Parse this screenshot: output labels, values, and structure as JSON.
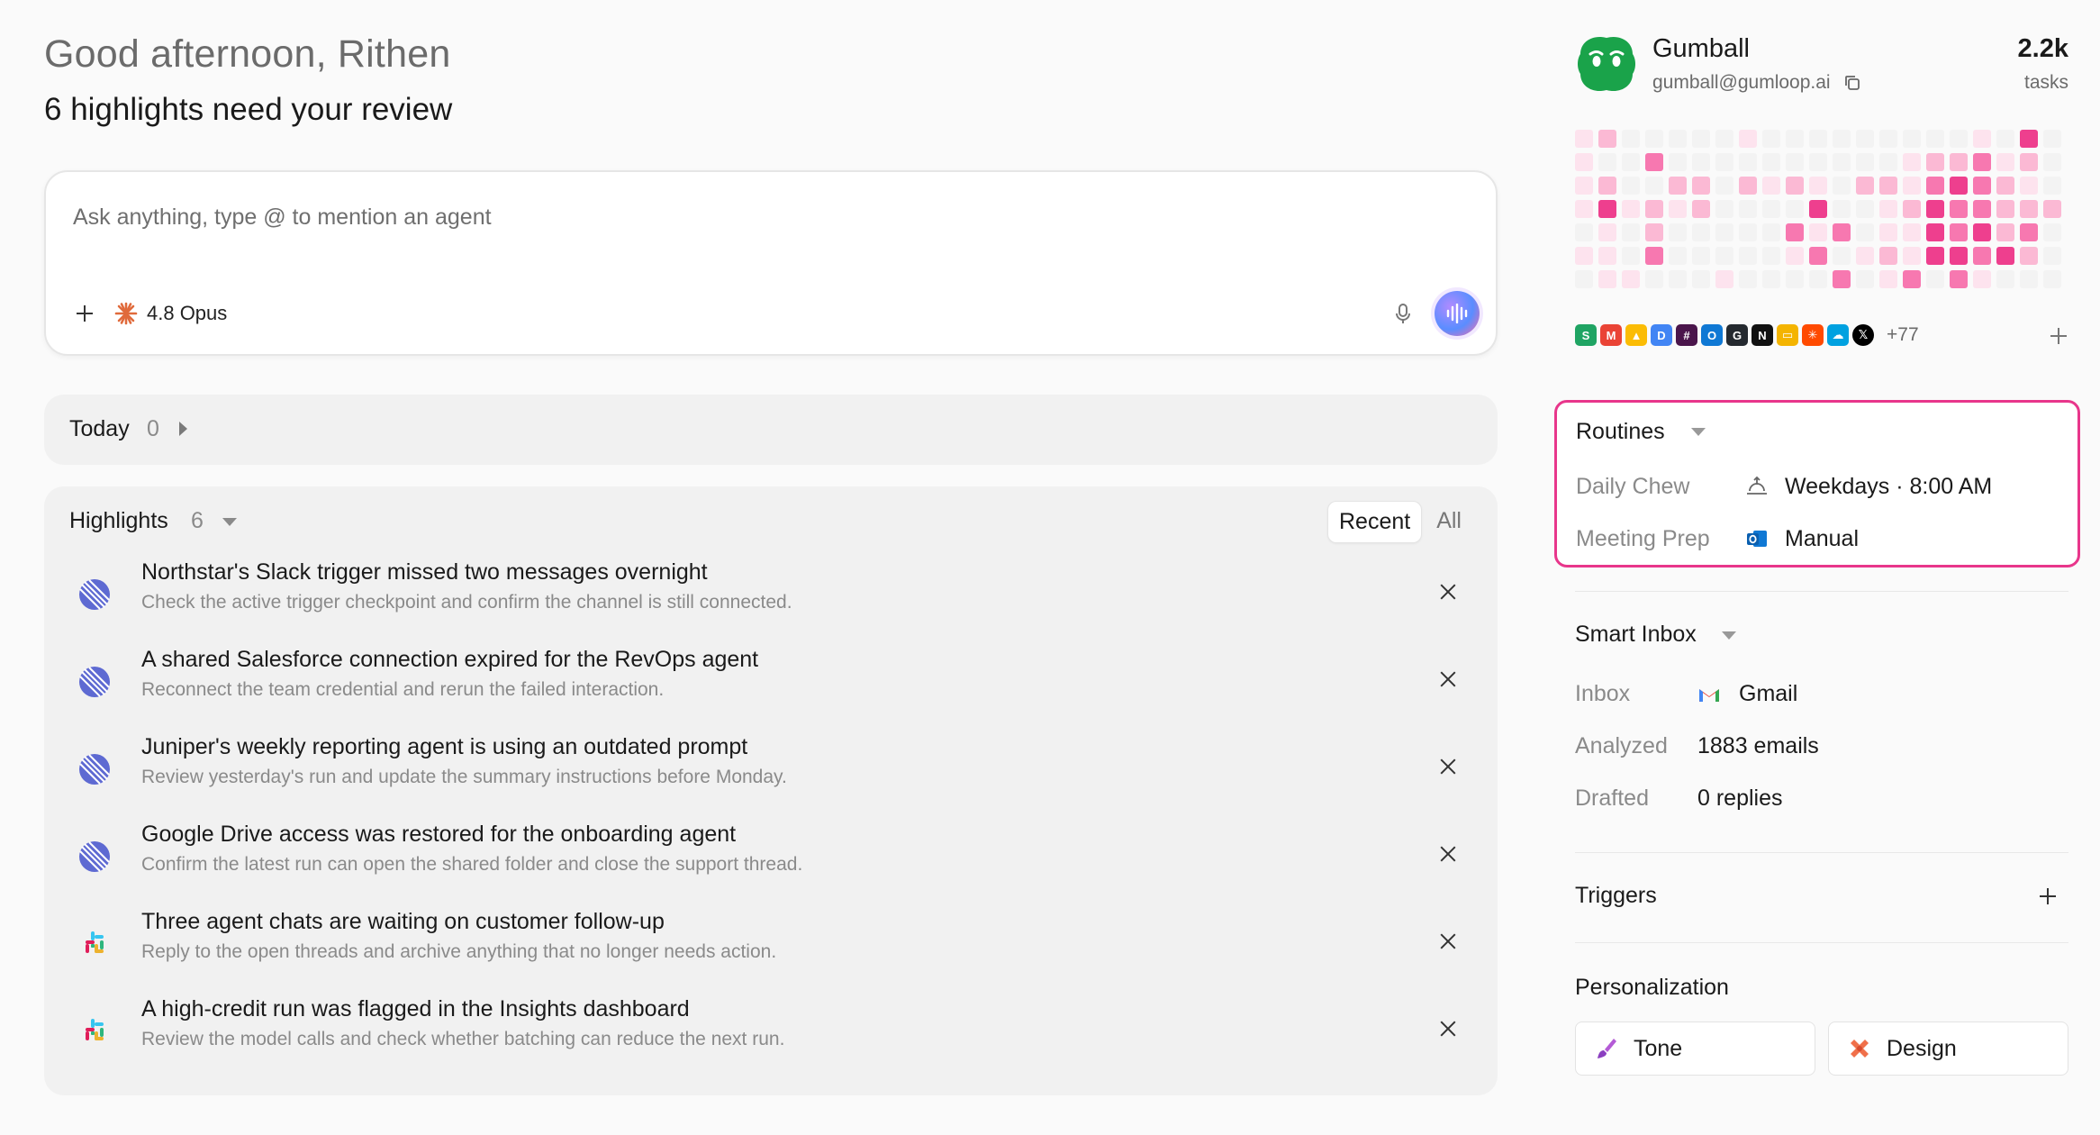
{
  "greeting": "Good afternoon, Rithen",
  "subtitle": "6 highlights need your review",
  "composer": {
    "placeholder": "Ask anything, type @ to mention an agent",
    "model": "4.8 Opus"
  },
  "today": {
    "label": "Today",
    "count": "0"
  },
  "highlights": {
    "title": "Highlights",
    "count": "6",
    "tabs": [
      "Recent",
      "All"
    ],
    "items": [
      {
        "title": "Northstar's Slack trigger missed two messages overnight",
        "desc": "Check the active trigger checkpoint and confirm the channel is still connected.",
        "icon": "linear-icon"
      },
      {
        "title": "A shared Salesforce connection expired for the RevOps agent",
        "desc": "Reconnect the team credential and rerun the failed interaction.",
        "icon": "linear-icon"
      },
      {
        "title": "Juniper's weekly reporting agent is using an outdated prompt",
        "desc": "Review yesterday's run and update the summary instructions before Monday.",
        "icon": "linear-icon"
      },
      {
        "title": "Google Drive access was restored for the onboarding agent",
        "desc": "Confirm the latest run can open the shared folder and close the support thread.",
        "icon": "linear-icon"
      },
      {
        "title": "Three agent chats are waiting on customer follow-up",
        "desc": "Reply to the open threads and archive anything that no longer needs action.",
        "icon": "slack-icon"
      },
      {
        "title": "A high-credit run was flagged in the Insights dashboard",
        "desc": "Review the model calls and check whether batching can reduce the next run.",
        "icon": "slack-icon"
      }
    ]
  },
  "agent": {
    "name": "Gumball",
    "email": "gumball@gumloop.ai",
    "tasks_value": "2.2k",
    "tasks_label": "tasks",
    "brand_color": "#1aa34a"
  },
  "integrations": {
    "icons": [
      "google-sheets-icon",
      "gmail-icon",
      "google-drive-icon",
      "google-docs-icon",
      "slack-icon",
      "outlook-icon",
      "github-icon",
      "notion-icon",
      "google-slides-icon",
      "zapier-icon",
      "salesforce-icon",
      "x-icon"
    ],
    "more": "+77"
  },
  "routines": {
    "title": "Routines",
    "highlight_color": "#e8368b",
    "items": [
      {
        "name": "Daily Chew",
        "schedule": "Weekdays · 8:00 AM",
        "icon": "sunrise-icon"
      },
      {
        "name": "Meeting Prep",
        "schedule": "Manual",
        "icon": "outlook-icon"
      }
    ]
  },
  "smart_inbox": {
    "title": "Smart Inbox",
    "rows": [
      {
        "label": "Inbox",
        "value": "Gmail"
      },
      {
        "label": "Analyzed",
        "value": "1883 emails"
      },
      {
        "label": "Drafted",
        "value": "0 replies"
      }
    ]
  },
  "triggers": {
    "title": "Triggers"
  },
  "personalization": {
    "title": "Personalization",
    "buttons": [
      "Tone",
      "Design"
    ]
  }
}
